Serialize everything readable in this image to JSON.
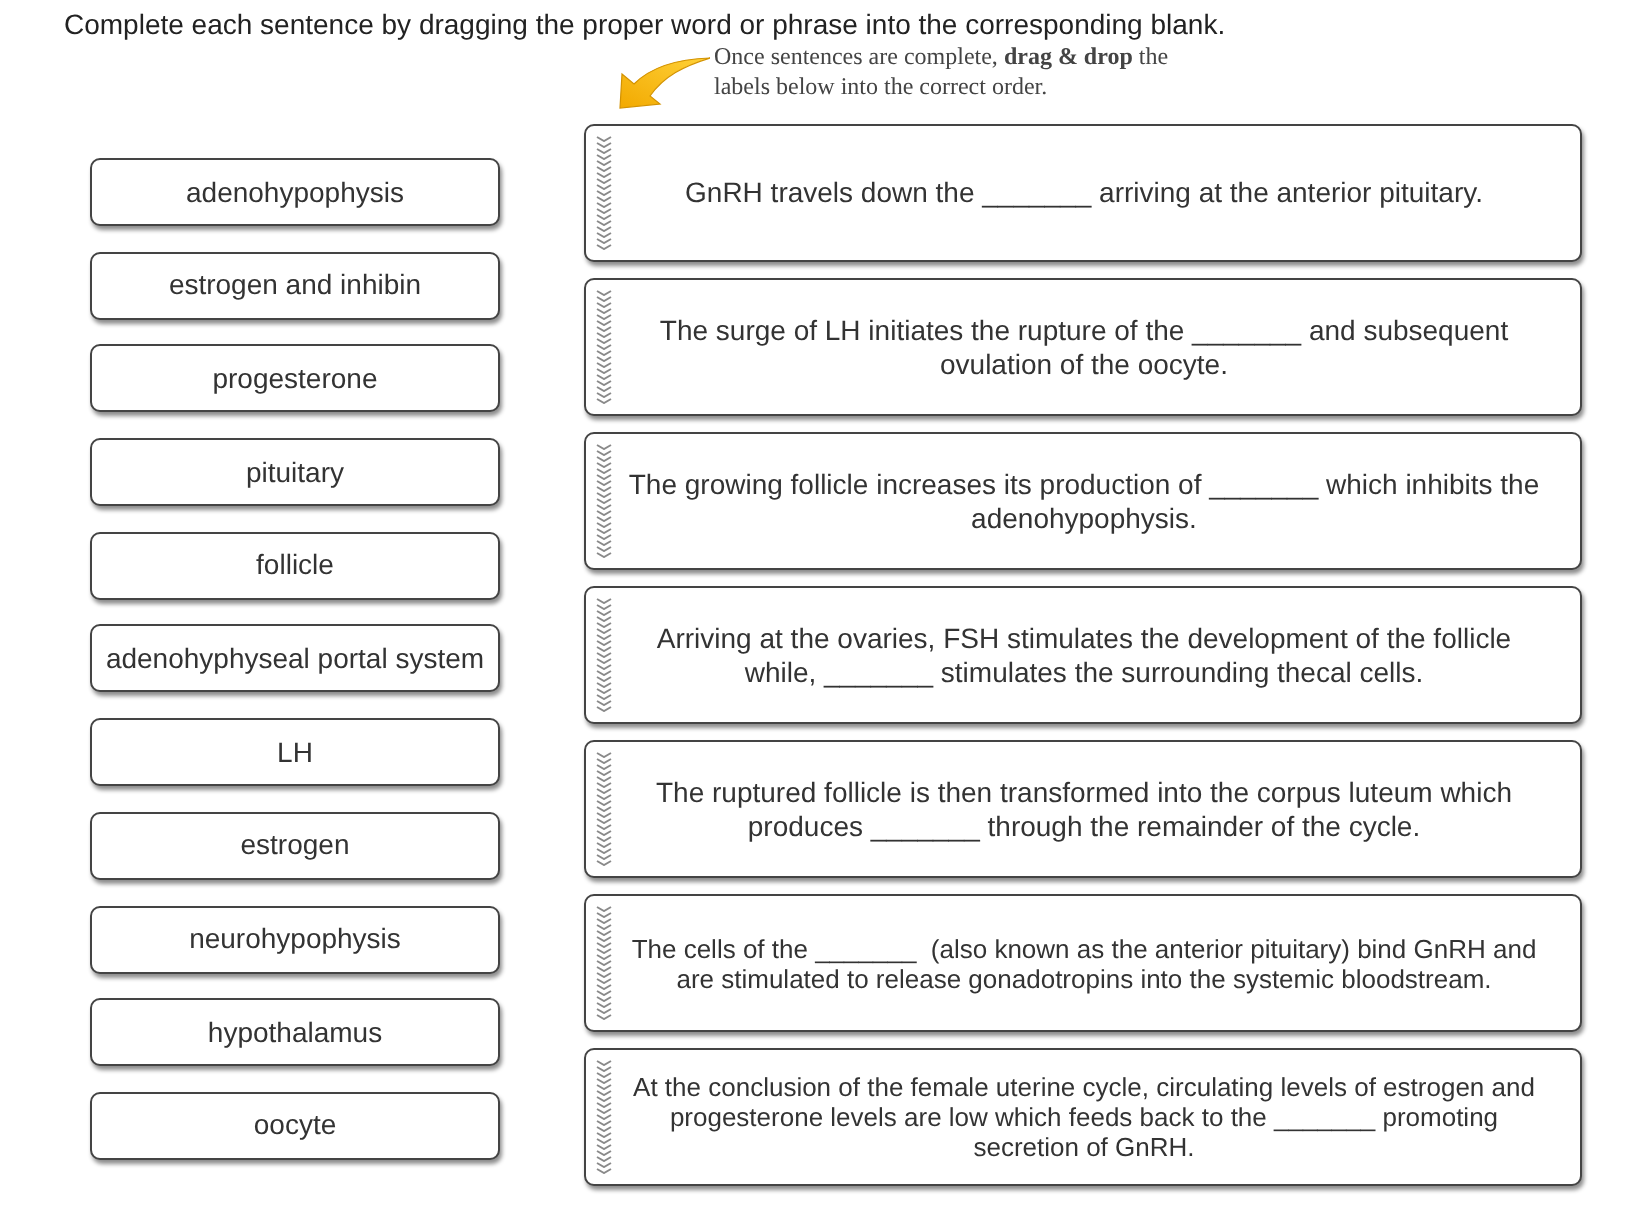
{
  "instructions": "Complete each sentence by dragging the proper word or phrase into the corresponding blank.",
  "hint": {
    "lines": [
      "Once sentences are complete, **drag & drop** the",
      "labels below into the correct order."
    ]
  },
  "labels": [
    "adenohypophysis",
    "estrogen and inhibin",
    "progesterone",
    "pituitary",
    "follicle",
    "adenohyphyseal portal system",
    "LH",
    "estrogen",
    "neurohypophysis",
    "hypothalamus",
    "oocyte"
  ],
  "sentences": [
    {
      "lines": [
        "GnRH travels down the _______ arriving at the anterior pituitary."
      ]
    },
    {
      "lines": [
        "The surge of LH initiates the rupture of the _______ and subsequent",
        "ovulation of the oocyte."
      ]
    },
    {
      "lines": [
        "The growing follicle increases its production of _______ which inhibits the",
        "adenohypophysis."
      ]
    },
    {
      "lines": [
        "Arriving at the ovaries, FSH stimulates the development of the follicle",
        "while, _______ stimulates the surrounding thecal cells."
      ]
    },
    {
      "lines": [
        "The ruptured follicle is then transformed into the corpus luteum which",
        "produces _______ through the remainder of the cycle."
      ]
    },
    {
      "lines": [
        "The cells of the _______  (also known as the anterior pituitary) bind GnRH and",
        "are stimulated to release gonadotropins into the systemic bloodstream."
      ]
    },
    {
      "lines": [
        "At the conclusion of the female uterine cycle, circulating levels of estrogen and",
        "progesterone levels are low which feeds back to the _______ promoting",
        "secretion of GnRH."
      ]
    }
  ]
}
